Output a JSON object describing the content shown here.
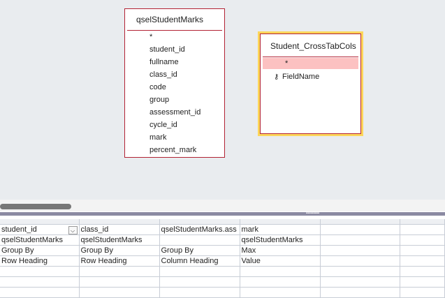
{
  "tables": [
    {
      "name": "qselStudentMarks",
      "fields": [
        "*",
        "student_id",
        "fullname",
        "class_id",
        "code",
        "group",
        "assessment_id",
        "cycle_id",
        "mark",
        "percent_mark"
      ]
    },
    {
      "name": "Student_CrossTabCols",
      "fields": [
        "*",
        "FieldName"
      ]
    }
  ],
  "grid": {
    "rows": [
      [
        "student_id",
        "class_id",
        "qselStudentMarks.ass",
        "mark",
        "",
        ""
      ],
      [
        "qselStudentMarks",
        "qselStudentMarks",
        "",
        "qselStudentMarks",
        "",
        ""
      ],
      [
        "Group By",
        "Group By",
        "Group By",
        "Max",
        "",
        ""
      ],
      [
        "Row Heading",
        "Row Heading",
        "Column Heading",
        "Value",
        "",
        ""
      ]
    ]
  },
  "colors": {
    "table_border": "#b22234",
    "selected_outline": "#fcd65a",
    "highlight_row": "#fcc1c1"
  }
}
